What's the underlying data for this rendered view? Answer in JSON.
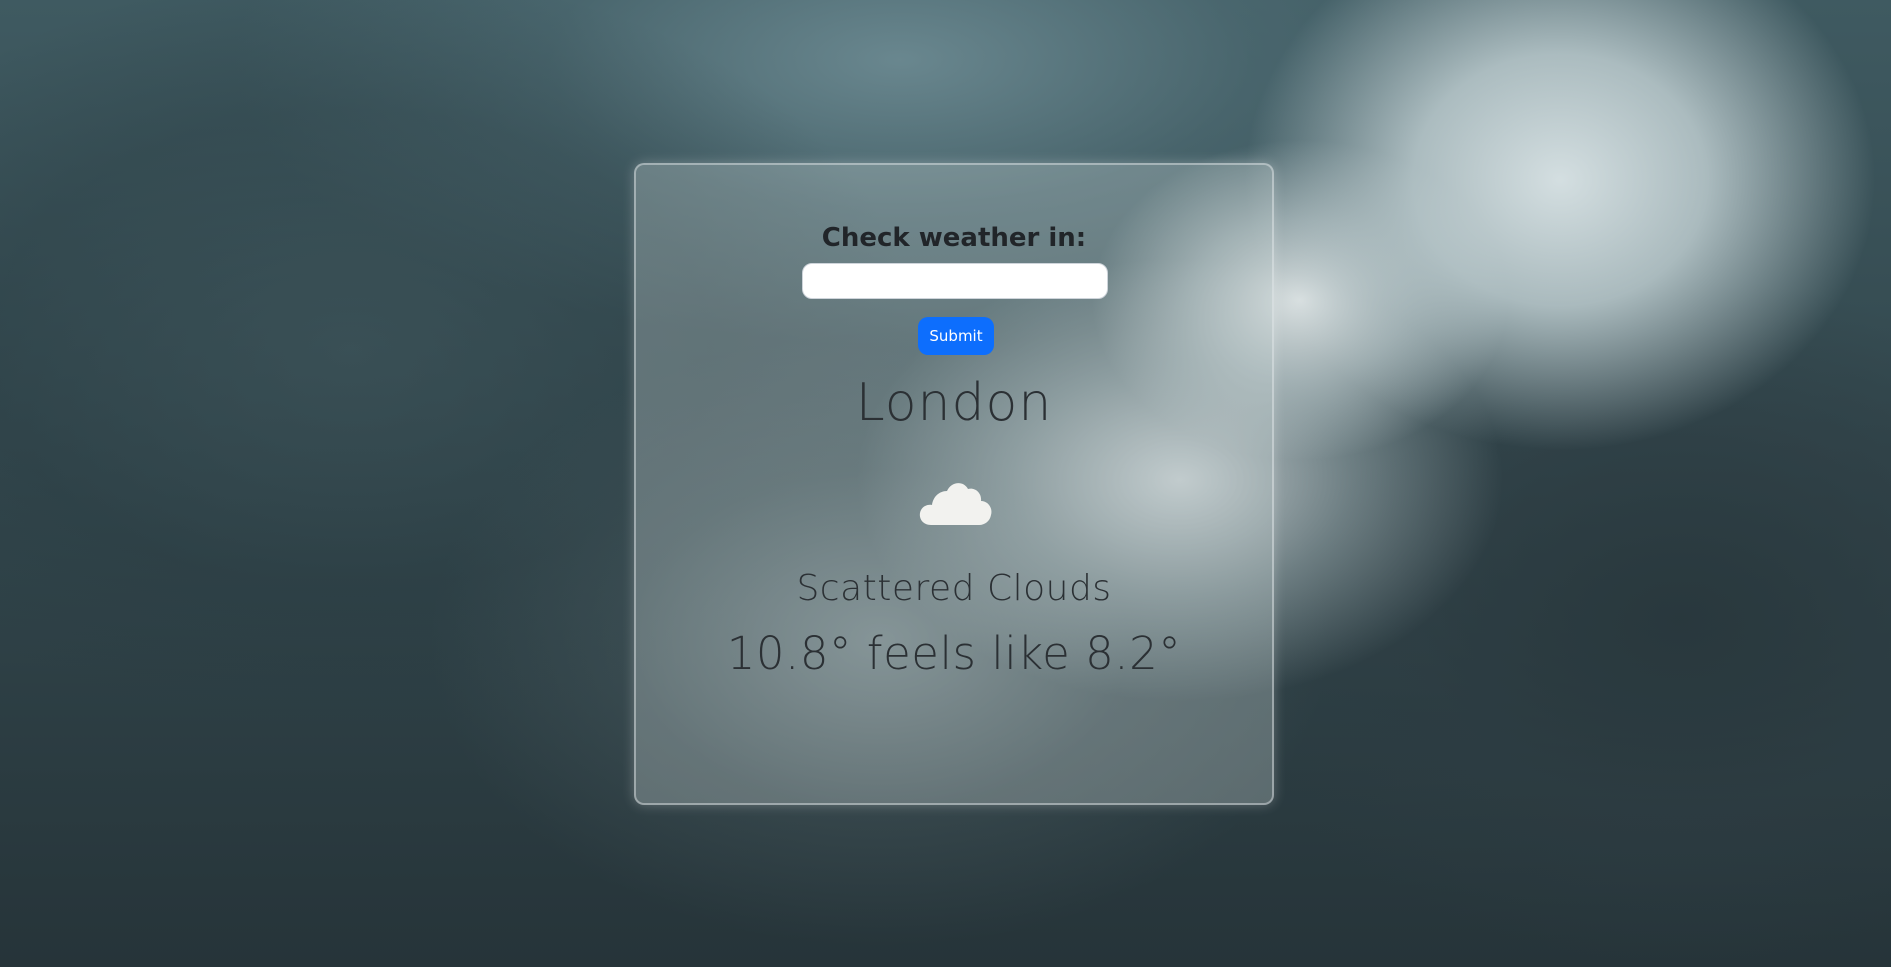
{
  "form": {
    "label": "Check weather in:",
    "input_value": "",
    "input_placeholder": "",
    "submit_label": "Submit"
  },
  "weather": {
    "city": "London",
    "icon": "cloud-icon",
    "description": "Scattered Clouds",
    "temperature_text": "10.8° feels like 8.2°",
    "temperature": 10.8,
    "feels_like": 8.2
  },
  "colors": {
    "submit_button": "#0d6efd",
    "text": "#212529",
    "icon": "#f2f2ef"
  }
}
